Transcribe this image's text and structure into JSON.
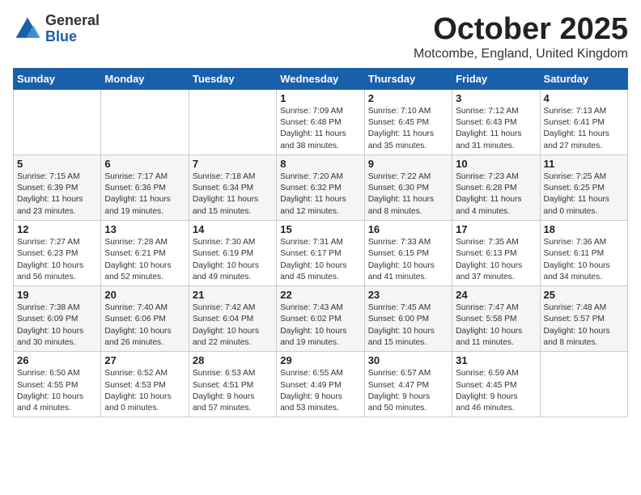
{
  "logo": {
    "general": "General",
    "blue": "Blue"
  },
  "title": "October 2025",
  "location": "Motcombe, England, United Kingdom",
  "days_of_week": [
    "Sunday",
    "Monday",
    "Tuesday",
    "Wednesday",
    "Thursday",
    "Friday",
    "Saturday"
  ],
  "weeks": [
    [
      {
        "day": "",
        "info": ""
      },
      {
        "day": "",
        "info": ""
      },
      {
        "day": "",
        "info": ""
      },
      {
        "day": "1",
        "info": "Sunrise: 7:09 AM\nSunset: 6:48 PM\nDaylight: 11 hours\nand 38 minutes."
      },
      {
        "day": "2",
        "info": "Sunrise: 7:10 AM\nSunset: 6:45 PM\nDaylight: 11 hours\nand 35 minutes."
      },
      {
        "day": "3",
        "info": "Sunrise: 7:12 AM\nSunset: 6:43 PM\nDaylight: 11 hours\nand 31 minutes."
      },
      {
        "day": "4",
        "info": "Sunrise: 7:13 AM\nSunset: 6:41 PM\nDaylight: 11 hours\nand 27 minutes."
      }
    ],
    [
      {
        "day": "5",
        "info": "Sunrise: 7:15 AM\nSunset: 6:39 PM\nDaylight: 11 hours\nand 23 minutes."
      },
      {
        "day": "6",
        "info": "Sunrise: 7:17 AM\nSunset: 6:36 PM\nDaylight: 11 hours\nand 19 minutes."
      },
      {
        "day": "7",
        "info": "Sunrise: 7:18 AM\nSunset: 6:34 PM\nDaylight: 11 hours\nand 15 minutes."
      },
      {
        "day": "8",
        "info": "Sunrise: 7:20 AM\nSunset: 6:32 PM\nDaylight: 11 hours\nand 12 minutes."
      },
      {
        "day": "9",
        "info": "Sunrise: 7:22 AM\nSunset: 6:30 PM\nDaylight: 11 hours\nand 8 minutes."
      },
      {
        "day": "10",
        "info": "Sunrise: 7:23 AM\nSunset: 6:28 PM\nDaylight: 11 hours\nand 4 minutes."
      },
      {
        "day": "11",
        "info": "Sunrise: 7:25 AM\nSunset: 6:25 PM\nDaylight: 11 hours\nand 0 minutes."
      }
    ],
    [
      {
        "day": "12",
        "info": "Sunrise: 7:27 AM\nSunset: 6:23 PM\nDaylight: 10 hours\nand 56 minutes."
      },
      {
        "day": "13",
        "info": "Sunrise: 7:28 AM\nSunset: 6:21 PM\nDaylight: 10 hours\nand 52 minutes."
      },
      {
        "day": "14",
        "info": "Sunrise: 7:30 AM\nSunset: 6:19 PM\nDaylight: 10 hours\nand 49 minutes."
      },
      {
        "day": "15",
        "info": "Sunrise: 7:31 AM\nSunset: 6:17 PM\nDaylight: 10 hours\nand 45 minutes."
      },
      {
        "day": "16",
        "info": "Sunrise: 7:33 AM\nSunset: 6:15 PM\nDaylight: 10 hours\nand 41 minutes."
      },
      {
        "day": "17",
        "info": "Sunrise: 7:35 AM\nSunset: 6:13 PM\nDaylight: 10 hours\nand 37 minutes."
      },
      {
        "day": "18",
        "info": "Sunrise: 7:36 AM\nSunset: 6:11 PM\nDaylight: 10 hours\nand 34 minutes."
      }
    ],
    [
      {
        "day": "19",
        "info": "Sunrise: 7:38 AM\nSunset: 6:09 PM\nDaylight: 10 hours\nand 30 minutes."
      },
      {
        "day": "20",
        "info": "Sunrise: 7:40 AM\nSunset: 6:06 PM\nDaylight: 10 hours\nand 26 minutes."
      },
      {
        "day": "21",
        "info": "Sunrise: 7:42 AM\nSunset: 6:04 PM\nDaylight: 10 hours\nand 22 minutes."
      },
      {
        "day": "22",
        "info": "Sunrise: 7:43 AM\nSunset: 6:02 PM\nDaylight: 10 hours\nand 19 minutes."
      },
      {
        "day": "23",
        "info": "Sunrise: 7:45 AM\nSunset: 6:00 PM\nDaylight: 10 hours\nand 15 minutes."
      },
      {
        "day": "24",
        "info": "Sunrise: 7:47 AM\nSunset: 5:58 PM\nDaylight: 10 hours\nand 11 minutes."
      },
      {
        "day": "25",
        "info": "Sunrise: 7:48 AM\nSunset: 5:57 PM\nDaylight: 10 hours\nand 8 minutes."
      }
    ],
    [
      {
        "day": "26",
        "info": "Sunrise: 6:50 AM\nSunset: 4:55 PM\nDaylight: 10 hours\nand 4 minutes."
      },
      {
        "day": "27",
        "info": "Sunrise: 6:52 AM\nSunset: 4:53 PM\nDaylight: 10 hours\nand 0 minutes."
      },
      {
        "day": "28",
        "info": "Sunrise: 6:53 AM\nSunset: 4:51 PM\nDaylight: 9 hours\nand 57 minutes."
      },
      {
        "day": "29",
        "info": "Sunrise: 6:55 AM\nSunset: 4:49 PM\nDaylight: 9 hours\nand 53 minutes."
      },
      {
        "day": "30",
        "info": "Sunrise: 6:57 AM\nSunset: 4:47 PM\nDaylight: 9 hours\nand 50 minutes."
      },
      {
        "day": "31",
        "info": "Sunrise: 6:59 AM\nSunset: 4:45 PM\nDaylight: 9 hours\nand 46 minutes."
      },
      {
        "day": "",
        "info": ""
      }
    ]
  ]
}
